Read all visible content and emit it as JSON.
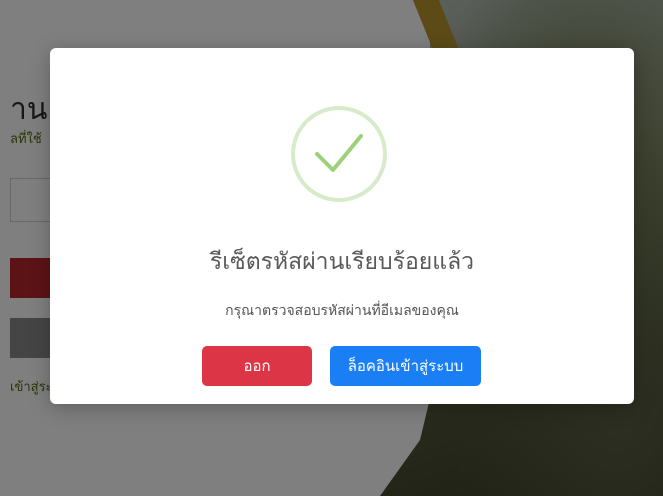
{
  "background": {
    "title": "าน",
    "subtitle": "ลที่ใช้",
    "link": "เข้าสู่ระ"
  },
  "modal": {
    "icon": "check-icon",
    "title": "รีเซ็ตรหัสผ่านเรียบร้อยแล้ว",
    "message": "กรุณาตรวจสอบรหัสผ่านที่อีเมลของคุณ",
    "exit_label": "ออก",
    "login_label": "ล็อคอินเข้าสู่ระบบ"
  },
  "colors": {
    "exit_button": "#dc3545",
    "login_button": "#1a7ff5",
    "check_stroke": "#9ed07a",
    "check_ring": "#d7ebcb"
  }
}
